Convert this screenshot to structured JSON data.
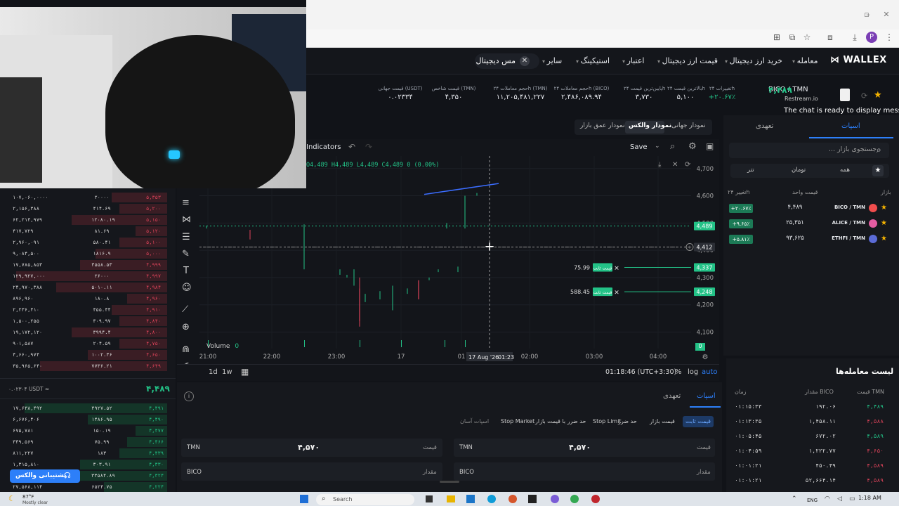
{
  "browser": {
    "profile_initial": "P"
  },
  "nav": {
    "logo": "WALLEX",
    "items": [
      "معامله",
      "خرید ارز دیجیتال",
      "قیمت ارز دیجیتال",
      "اعتبار",
      "استیکینگ",
      "سایر"
    ],
    "user": "مس دیجیتال"
  },
  "ticker": {
    "pair": "BICO / TMN",
    "price": "۴,۴۸۹",
    "restream": "Restream.io",
    "chat_msg": "The chat is ready to display messag",
    "stats": [
      {
        "label": "تغییرات ۲۴h",
        "value": "+۲۰.۶۷٪"
      },
      {
        "label": "بالاترین قیمت ۲۴h",
        "value": "۵,۱۰۰"
      },
      {
        "label": "پایین‌ترین قیمت ۲۴h",
        "value": "۳,۷۳۰"
      },
      {
        "label": "حجم معاملات ۲۴h (BICO)",
        "value": "۲,۴۸۶,۰۸۹.۹۴"
      },
      {
        "label": "حجم معاملات ۲۴h (TMN)",
        "value": "۱۱,۲۰۵,۴۸۱,۲۲۷"
      },
      {
        "label": "قیمت شاخص (TMN)",
        "value": "۴,۳۵۰"
      },
      {
        "label": "قیمت جهانی (USDT)",
        "value": "۰.۰۲۳۳۴"
      }
    ]
  },
  "chart_tabs": [
    "نمودار جهانی",
    "نمودار والکس",
    "نمودار عمق بازار"
  ],
  "chart_toolbar": {
    "indicators": "Indicators",
    "save": "Save"
  },
  "chart_data": {
    "type": "candlestick",
    "ohlc_text": "O4,489 H4,489 L4,489 C4,489 0 (0.00%)",
    "y_ticks": [
      "4,700",
      "4,600",
      "4,500",
      "4,400",
      "4,300",
      "4,200",
      "4,100"
    ],
    "x_ticks": [
      "21:00",
      "22:00",
      "23:00",
      "17",
      "01",
      "02:00",
      "03:00",
      "04:00"
    ],
    "crosshair_date": "17 Aug '26",
    "crosshair_time": "01:23",
    "price_tags": [
      "4,489",
      "4,412",
      "4,337",
      "4,248"
    ],
    "orders": [
      {
        "qty": "75.99",
        "label": "قیمت ثابت",
        "price": "4,337"
      },
      {
        "qty": "588.45",
        "label": "قیمت ثابت",
        "price": "4,248"
      }
    ],
    "volume_label": "Volume",
    "volume_value": "0",
    "volume_box": "0",
    "timeframes": [
      "1d",
      "1w"
    ],
    "clock": "01:18:46 (UTC+3:30)",
    "scale_opts": [
      "%",
      "log",
      "auto"
    ]
  },
  "market": {
    "search_placeholder": "جستجوی بازار ...",
    "tabs": [
      "اسپات",
      "تعهدی"
    ],
    "filters": [
      "همه",
      "تومان",
      "تتر"
    ],
    "cols": [
      "بازار",
      "قیمت واحد",
      "تغییر ۲۴h"
    ],
    "rows": [
      {
        "pair": "BICO / TMN",
        "price": "۴,۴۸۹",
        "change": "+۲۰.۶۷٪"
      },
      {
        "pair": "ALICE / TMN",
        "price": "۲۵,۳۵۱",
        "change": "+۹.۶۵٪"
      },
      {
        "pair": "ETHFI / TMN",
        "price": "۹۳,۶۲۵",
        "change": "+۵.۸۱٪"
      }
    ]
  },
  "orderbook": {
    "asks": [
      [
        "۲۰۰۰۰",
        "۱۰۷,۰۶۰,۰۰۰۰",
        "۵,۳۵۳"
      ],
      [
        "۴۱۴.۶۹",
        "۲,۱۵۶,۳۸۸",
        "۵,۲۰۰"
      ],
      [
        "۱۲۰۸۰.۱۹",
        "۶۲,۲۱۴,۹۷۹",
        "۵,۱۵۰"
      ],
      [
        "۸۱.۶۹",
        "۴۱۷,۷۲۹",
        "۵,۱۲۰"
      ],
      [
        "۵۸۰.۴۱",
        "۲,۹۶۰,۰۹۱",
        "۵,۱۰۰"
      ],
      [
        "۱۸۱۶.۹",
        "۹,۰۸۴,۵۰۰",
        "۵,۰۰۰"
      ],
      [
        "۳۵۵۸.۵۳",
        "۱۷,۷۸۵,۸۵۳",
        "۴,۹۹۹"
      ],
      [
        "۲۶۰۰۰",
        "۱۲۹,۹۲۷,۰۰۰",
        "۴,۹۹۷"
      ],
      [
        "۵۰۱۰.۱۱",
        "۲۴,۹۷۰,۳۸۸",
        "۴,۹۸۴"
      ],
      [
        "۱۸۰.۸",
        "۸۹۶,۹۶۰",
        "۴,۹۶۰"
      ],
      [
        "۴۵۵.۴۴",
        "۲,۲۳۶,۴۱۰",
        "۴,۹۱۰"
      ],
      [
        "۳۰۹.۹۷",
        "۱,۵۰۰,۲۵۵",
        "۴,۸۴۰"
      ],
      [
        "۳۹۹۴.۴",
        "۱۹,۱۷۲,۱۲۰",
        "۴,۸۰۰"
      ],
      [
        "۲۰۴.۵۹",
        "۹۰۱,۵۸۷",
        "۴,۷۵۰"
      ],
      [
        "۱۰۰۲.۳۶",
        "۴,۶۶۰,۹۷۴",
        "۴,۶۵۰"
      ],
      [
        "۷۷۳۶.۲۱",
        "۳۵,۹۶۵,۶۴۰",
        "۴,۶۴۹"
      ]
    ],
    "mid_price": "۴,۴۸۹",
    "mid_usdt": "۰.۰۲۳۰۴ USDT ≈",
    "bids": [
      [
        "۳۹۲۷.۵۲",
        "۱۷,۶۳۸,۴۹۲",
        "۴,۴۹۱"
      ],
      [
        "۱۴۸۶.۹۵",
        "۶,۶۷۶,۴۰۶",
        "۴,۴۹۰"
      ],
      [
        "۱۵۰.۱۹",
        "۶۷۵,۷۸۱",
        "۴,۴۷۷"
      ],
      [
        "۷۵.۹۹",
        "۳۳۹,۵۶۹",
        "۴,۴۶۶"
      ],
      [
        "۱۸۳",
        "۸۱۱,۲۲۷",
        "۴,۴۳۹"
      ],
      [
        "۳۰۳.۹۱",
        "۱,۳۱۵,۸۱۰",
        "۴,۳۳۰"
      ],
      [
        "۳۳۵۸۴.۸۹",
        "۳۵,۸۶۸,۹۷۱",
        "۴,۳۲۴"
      ],
      [
        "۶۵۲۴.۷۵",
        "۲۷,۵۶۸,۱۱۴",
        "۴,۲۲۴"
      ]
    ],
    "support": "پشتیبانی والکس"
  },
  "order_form": {
    "tabs": [
      "اسپات",
      "تعهدی"
    ],
    "types": [
      "قیمت ثابت",
      "قیمت بازار",
      "حد ضرر",
      "Stop Limit",
      "حد ضرر با قیمت بازار",
      "Stop Market",
      "اسپات آسان"
    ],
    "buy": {
      "price_label": "قیمت",
      "price": "۴,۵۷۰",
      "currency": "TMN",
      "amount_label": "مقدار",
      "amount_currency": "BICO"
    },
    "sell": {
      "price_label": "قیمت",
      "price": "۴,۵۷۰",
      "currency": "TMN",
      "amount_label": "مقدار",
      "amount_currency": "BICO"
    }
  },
  "trades": {
    "title": "لیست معامله‌ها",
    "cols": [
      "قیمت TMN",
      "مقدار BICO",
      "زمان"
    ],
    "rows": [
      {
        "price": "۴,۴۸۹",
        "amount": "۱۹۲.۰۶",
        "time": "۰۱:۱۵:۳۳",
        "side": "buy"
      },
      {
        "price": "۴,۵۸۸",
        "amount": "۱,۴۵۸.۱۱",
        "time": "۰۱:۱۳:۳۵",
        "side": "sell"
      },
      {
        "price": "۴,۵۸۹",
        "amount": "۶۷۲.۰۲",
        "time": "۰۱:۰۵:۴۵",
        "side": "buy"
      },
      {
        "price": "۴,۶۵۰",
        "amount": "۱,۲۲۲.۷۷",
        "time": "۰۱:۰۴:۵۹",
        "side": "sell"
      },
      {
        "price": "۴,۵۸۹",
        "amount": "۴۵۰.۴۹",
        "time": "۰۱:۰۱:۲۱",
        "side": "sell"
      },
      {
        "price": "۴,۵۸۹",
        "amount": "۵۲,۶۶۴.۱۴",
        "time": "۰۱:۰۱:۲۱",
        "side": "sell"
      }
    ]
  },
  "taskbar": {
    "weather_temp": "87°F",
    "weather_desc": "Mostly clear",
    "search": "Search",
    "lang": "ENG",
    "time": "1:18 AM"
  },
  "colors": {
    "green": "#23c287",
    "red": "#e0445b",
    "blue": "#2d7ff9",
    "bg": "#111318"
  }
}
